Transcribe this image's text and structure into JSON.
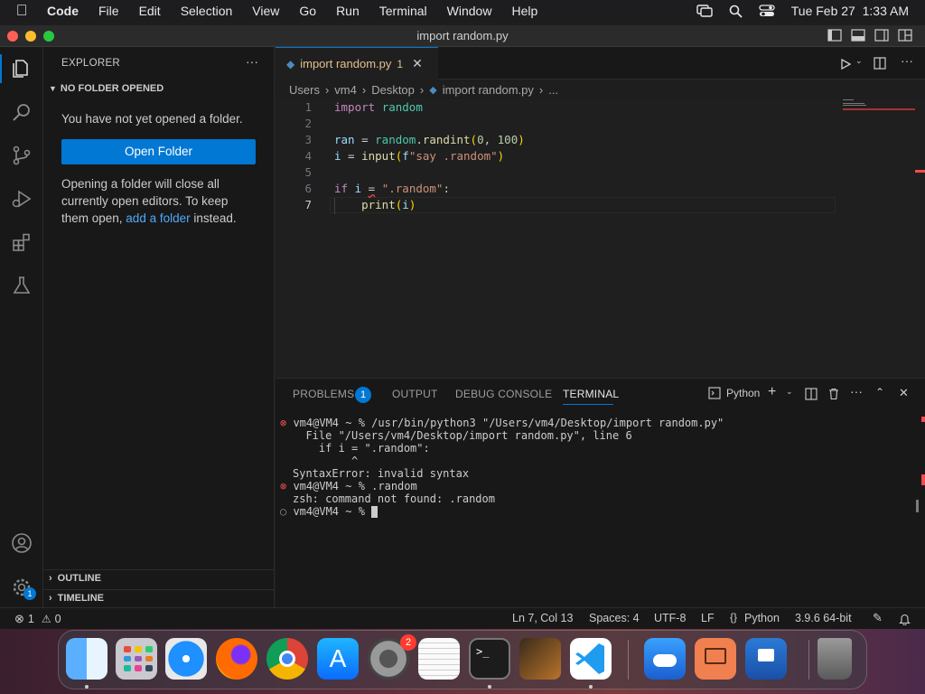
{
  "menubar": {
    "app": "Code",
    "items": [
      "File",
      "Edit",
      "Selection",
      "View",
      "Go",
      "Run",
      "Terminal",
      "Window",
      "Help"
    ],
    "datetime": "Tue Feb 27  1:33 AM"
  },
  "window": {
    "title": "import random.py"
  },
  "sidebar": {
    "header": "EXPLORER",
    "section": "NO FOLDER OPENED",
    "message": "You have not yet opened a folder.",
    "open_button": "Open Folder",
    "note_part1": "Opening a folder will close all currently open editors. To keep them open, ",
    "note_link": "add a folder",
    "note_part2": " instead.",
    "outline": "OUTLINE",
    "timeline": "TIMELINE"
  },
  "editor": {
    "tab_label": "import random.py",
    "tab_problems": "1",
    "breadcrumb": [
      "Users",
      "vm4",
      "Desktop",
      "import random.py",
      "..."
    ],
    "line_numbers": [
      "1",
      "2",
      "3",
      "4",
      "5",
      "6",
      "7"
    ],
    "active_line": "7"
  },
  "panel": {
    "tabs": [
      "PROBLEMS",
      "OUTPUT",
      "DEBUG CONSOLE",
      "TERMINAL"
    ],
    "problems_count": "1",
    "terminal_profile": "Python",
    "terminal_lines": [
      "vm4@VM4 ~ % /usr/bin/python3 \"/Users/vm4/Desktop/import random.py\"",
      "  File \"/Users/vm4/Desktop/import random.py\", line 6",
      "    if i = \".random\":",
      "         ^",
      "SyntaxError: invalid syntax",
      "vm4@VM4 ~ % .random",
      "zsh: command not found: .random",
      "vm4@VM4 ~ % "
    ]
  },
  "statusbar": {
    "errors": "1",
    "warnings": "0",
    "position": "Ln 7, Col 13",
    "spaces": "Spaces: 4",
    "encoding": "UTF-8",
    "eol": "LF",
    "language": "Python",
    "interpreter": "3.9.6 64-bit"
  },
  "dock": {
    "settings_badge": "2"
  },
  "colors": {
    "accent": "#0078d4",
    "error": "#f14c4c",
    "warning_tab": "#e2c08d"
  }
}
